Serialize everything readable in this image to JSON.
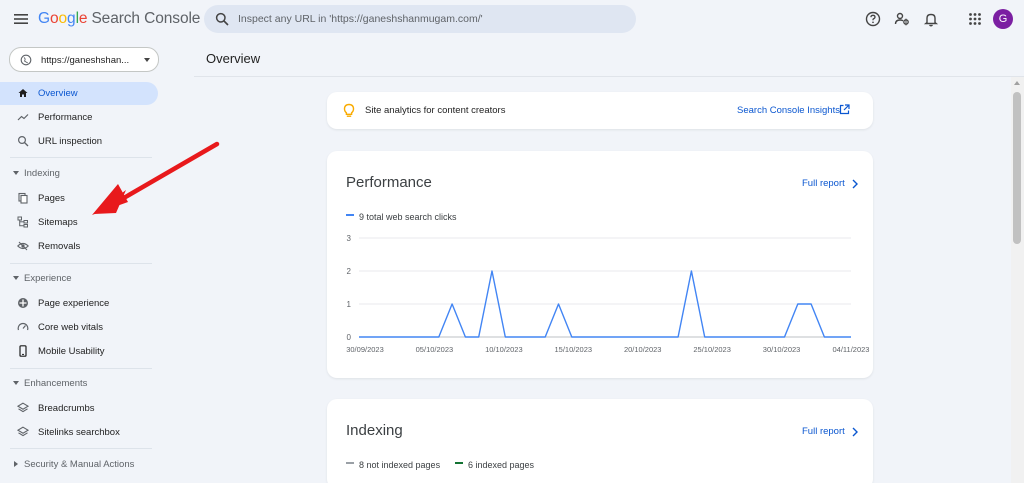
{
  "header": {
    "logo_letters": [
      "G",
      "o",
      "o",
      "g",
      "l",
      "e"
    ],
    "product": "Search Console",
    "search_placeholder": "Inspect any URL in 'https://ganeshshanmugam.com/'",
    "avatar_letter": "G",
    "icons": [
      "menu-icon",
      "help-icon",
      "users-icon",
      "bell-icon",
      "apps-icon"
    ]
  },
  "sidebar": {
    "property": "https://ganeshshan...",
    "items": [
      {
        "label": "Overview",
        "icon": "home-icon",
        "active": true
      },
      {
        "label": "Performance",
        "icon": "trending-icon"
      },
      {
        "label": "URL inspection",
        "icon": "search-icon"
      }
    ],
    "sections": [
      {
        "label": "Indexing",
        "items": [
          {
            "label": "Pages",
            "icon": "pages-icon"
          },
          {
            "label": "Sitemaps",
            "icon": "sitemap-icon"
          },
          {
            "label": "Removals",
            "icon": "removals-icon"
          }
        ]
      },
      {
        "label": "Experience",
        "items": [
          {
            "label": "Page experience",
            "icon": "page-experience-icon"
          },
          {
            "label": "Core web vitals",
            "icon": "gauge-icon"
          },
          {
            "label": "Mobile Usability",
            "icon": "mobile-icon"
          }
        ]
      },
      {
        "label": "Enhancements",
        "items": [
          {
            "label": "Breadcrumbs",
            "icon": "layers-icon"
          },
          {
            "label": "Sitelinks searchbox",
            "icon": "layers-icon"
          }
        ]
      },
      {
        "label": "Security & Manual Actions",
        "items": []
      }
    ]
  },
  "main": {
    "title": "Overview",
    "insights": {
      "text": "Site analytics for content creators",
      "link": "Search Console Insights"
    },
    "performance": {
      "title": "Performance",
      "full_report": "Full report",
      "legend": "9 total web search clicks",
      "legend_color": "#4285f4"
    },
    "indexing": {
      "title": "Indexing",
      "full_report": "Full report",
      "legend": [
        {
          "text": "8 not indexed pages",
          "color": "#9aa0a6"
        },
        {
          "text": "6 indexed pages",
          "color": "#137333"
        }
      ]
    }
  },
  "chart_data": {
    "type": "line",
    "series": [
      {
        "name": "9 total web search clicks",
        "color": "#4285f4"
      }
    ],
    "x_tick_labels": [
      "30/09/2023",
      "05/10/2023",
      "10/10/2023",
      "15/10/2023",
      "20/10/2023",
      "25/10/2023",
      "30/10/2023",
      "04/11/2023"
    ],
    "y_tick_labels": [
      "0",
      "1",
      "2",
      "3"
    ],
    "ylim": [
      0,
      3
    ],
    "x": [
      "30/09/2023",
      "01/10/2023",
      "02/10/2023",
      "03/10/2023",
      "04/10/2023",
      "05/10/2023",
      "06/10/2023",
      "07/10/2023",
      "08/10/2023",
      "09/10/2023",
      "10/10/2023",
      "11/10/2023",
      "12/10/2023",
      "13/10/2023",
      "14/10/2023",
      "15/10/2023",
      "16/10/2023",
      "17/10/2023",
      "18/10/2023",
      "19/10/2023",
      "20/10/2023",
      "21/10/2023",
      "22/10/2023",
      "23/10/2023",
      "24/10/2023",
      "25/10/2023",
      "26/10/2023",
      "27/10/2023",
      "28/10/2023",
      "29/10/2023",
      "30/10/2023",
      "31/10/2023",
      "01/11/2023",
      "02/11/2023",
      "03/11/2023",
      "04/11/2023"
    ],
    "values": [
      0,
      0,
      0,
      0,
      0,
      0,
      0,
      1,
      0,
      0,
      2,
      0,
      0,
      0,
      0,
      1,
      0,
      0,
      0,
      0,
      0,
      0,
      0,
      0,
      0,
      2,
      0,
      0,
      0,
      0,
      0,
      0,
      0,
      1,
      1,
      0,
      0,
      0
    ],
    "grid": true
  }
}
